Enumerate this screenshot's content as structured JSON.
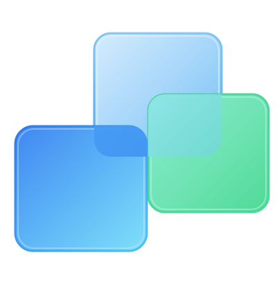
{
  "graphic": {
    "icon_name": "overlapping-rounded-squares-icon",
    "shapes": [
      {
        "name": "back-square",
        "color_top": "#bfe3fb",
        "color_bottom": "#5fb8f3"
      },
      {
        "name": "right-square",
        "color_top": "#7ee9c8",
        "color_bottom": "#3fd68f"
      },
      {
        "name": "front-square",
        "color_top": "#3f8ef3",
        "color_bottom": "#6ad8f7"
      }
    ],
    "background": "#ffffff"
  }
}
